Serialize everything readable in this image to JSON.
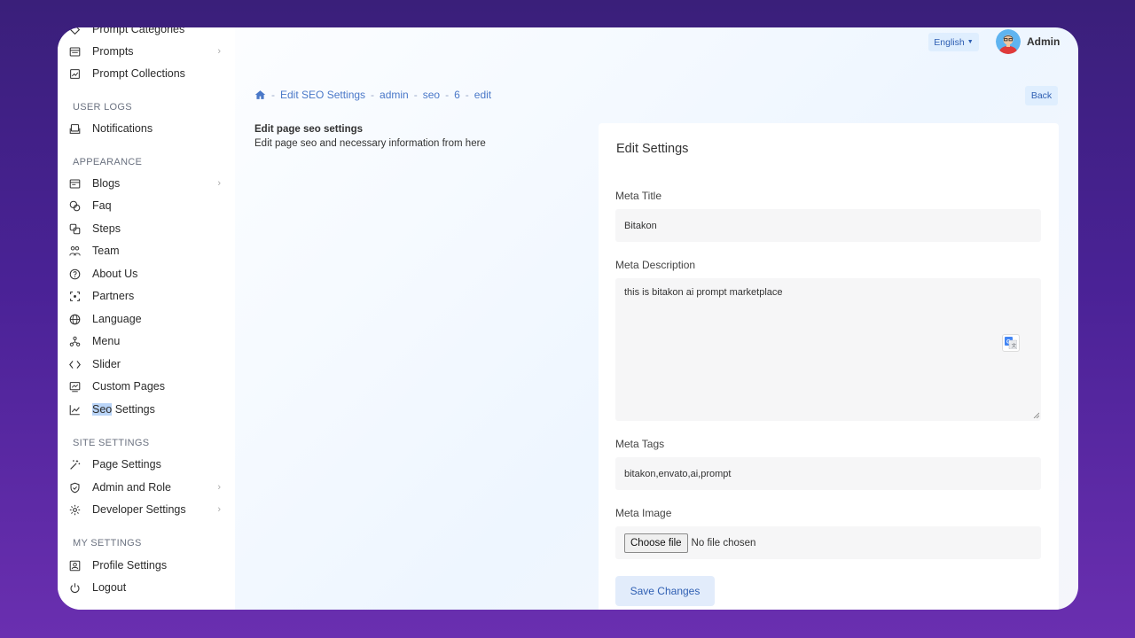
{
  "sidebar": {
    "top_items": [
      {
        "label": "Prompt Categories",
        "icon": "tag-icon"
      },
      {
        "label": "Prompts",
        "icon": "list-icon",
        "has_submenu": true
      },
      {
        "label": "Prompt Collections",
        "icon": "collection-icon"
      }
    ],
    "sections": {
      "user_logs": "USER LOGS",
      "appearance": "APPEARANCE",
      "site_settings": "SITE SETTINGS",
      "my_settings": "MY SETTINGS"
    },
    "user_logs_items": [
      {
        "label": "Notifications",
        "icon": "bell-icon"
      }
    ],
    "appearance_items": [
      {
        "label": "Blogs",
        "icon": "blog-icon",
        "has_submenu": true
      },
      {
        "label": "Faq",
        "icon": "faq-icon"
      },
      {
        "label": "Steps",
        "icon": "steps-icon"
      },
      {
        "label": "Team",
        "icon": "team-icon"
      },
      {
        "label": "About Us",
        "icon": "info-icon"
      },
      {
        "label": "Partners",
        "icon": "partners-icon"
      },
      {
        "label": "Language",
        "icon": "globe-icon"
      },
      {
        "label": "Menu",
        "icon": "menu-icon"
      },
      {
        "label": "Slider",
        "icon": "slider-icon"
      },
      {
        "label": "Custom Pages",
        "icon": "pages-icon"
      },
      {
        "label": "Seo Settings",
        "icon": "chart-icon",
        "selected_part": "Seo",
        "rest": " Settings"
      }
    ],
    "site_settings_items": [
      {
        "label": "Page Settings",
        "icon": "wand-icon"
      },
      {
        "label": "Admin and Role",
        "icon": "shield-icon",
        "has_submenu": true
      },
      {
        "label": "Developer Settings",
        "icon": "gear-icon",
        "has_submenu": true
      }
    ],
    "my_settings_items": [
      {
        "label": "Profile Settings",
        "icon": "profile-icon"
      },
      {
        "label": "Logout",
        "icon": "power-icon"
      }
    ]
  },
  "topbar": {
    "language": "English",
    "user_name": "Admin"
  },
  "breadcrumb": [
    "Edit SEO Settings",
    "admin",
    "seo",
    "6",
    "edit"
  ],
  "back_label": "Back",
  "intro": {
    "title": "Edit page seo settings",
    "description": "Edit page seo and necessary information from here"
  },
  "form": {
    "card_title": "Edit Settings",
    "meta_title_label": "Meta Title",
    "meta_title_value": "Bitakon",
    "meta_description_label": "Meta Description",
    "meta_description_value": "this is bitakon ai prompt marketplace",
    "meta_tags_label": "Meta Tags",
    "meta_tags_value": "bitakon,envato,ai,prompt",
    "meta_image_label": "Meta Image",
    "file_button_label": "Choose file",
    "file_status": "No file chosen",
    "save_label": "Save Changes"
  },
  "colors": {
    "accent": "#4a78c8",
    "button_bg": "#e2ecfb",
    "background_purple": "#4a2296"
  }
}
